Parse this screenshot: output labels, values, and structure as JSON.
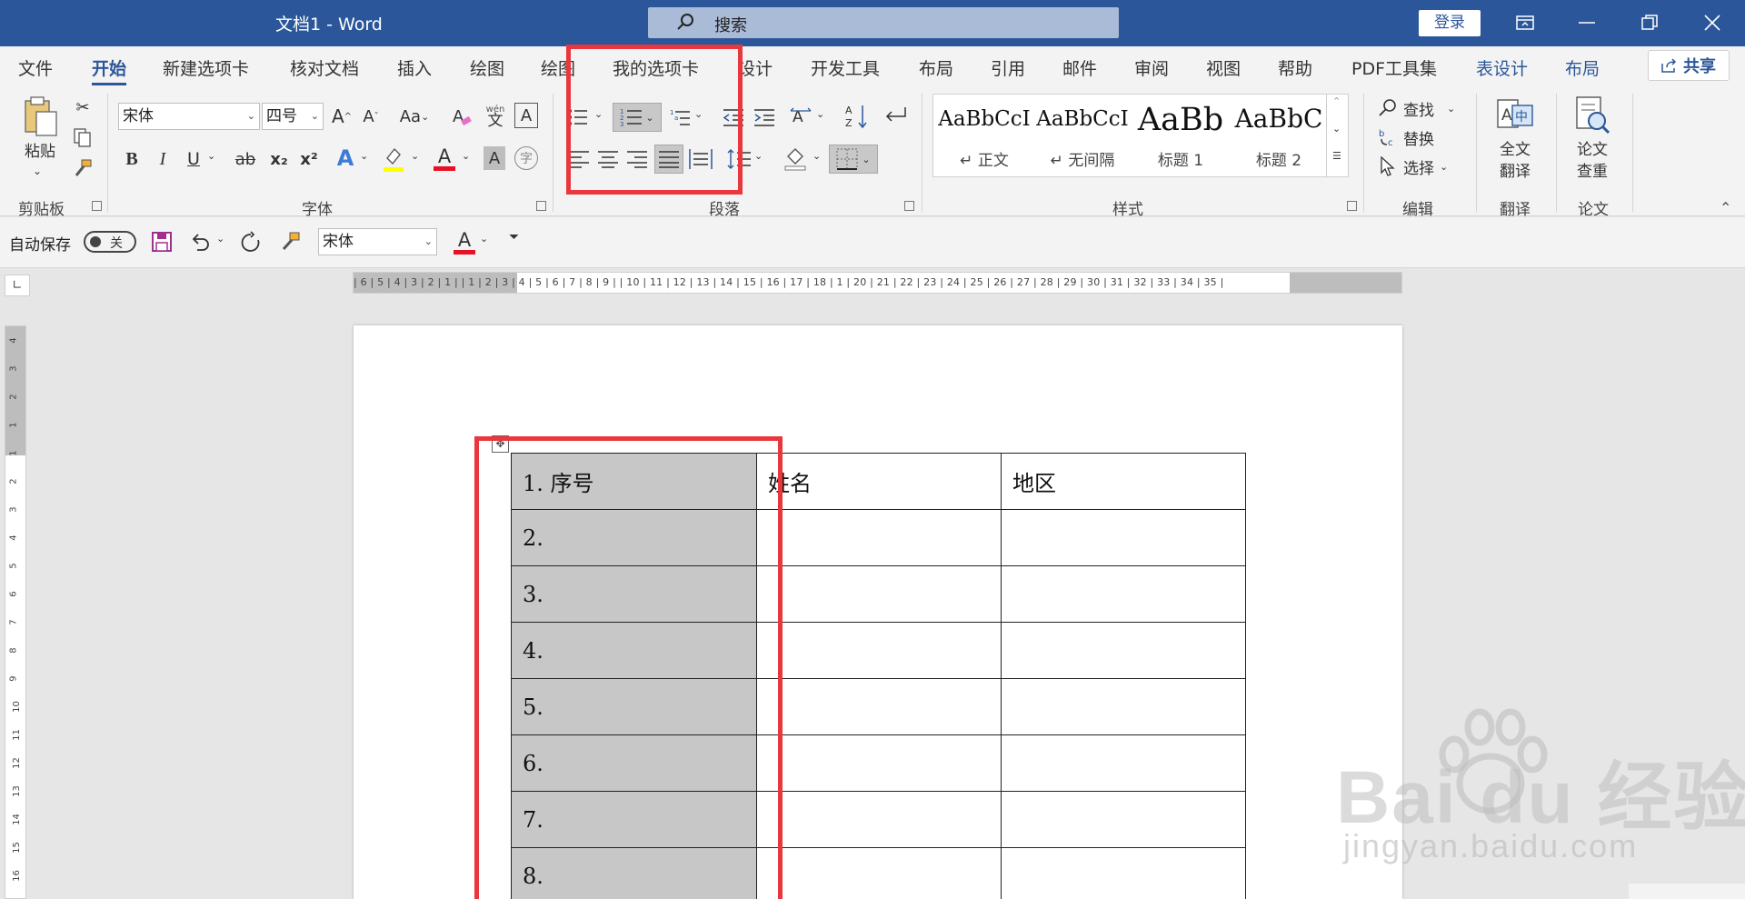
{
  "titlebar": {
    "doc_title": "文档1  -  Word",
    "search_placeholder": "搜索",
    "login": "登录"
  },
  "tabs": [
    "文件",
    "开始",
    "新建选项卡",
    "核对文档",
    "插入",
    "绘图",
    "绘图",
    "我的选项卡",
    "设计",
    "开发工具",
    "布局",
    "引用",
    "邮件",
    "审阅",
    "视图",
    "帮助",
    "PDF工具集",
    "表设计",
    "布局"
  ],
  "active_tab": "开始",
  "share": "共享",
  "ribbon": {
    "clipboard": {
      "label": "剪贴板",
      "paste": "粘贴"
    },
    "font": {
      "label": "字体",
      "font_name": "宋体",
      "font_size": "四号",
      "change_case": "Aa",
      "phonetic": "wén",
      "bold": "B",
      "italic": "I",
      "underline": "U",
      "strike": "ab",
      "subscript": "x₂",
      "superscript": "x²",
      "highlight_color": "#ffff00",
      "font_color": "#e81123",
      "enclose": "字"
    },
    "paragraph": {
      "label": "段落"
    },
    "styles": {
      "label": "样式",
      "items": [
        {
          "preview": "AaBbCcI",
          "name": "↵ 正文"
        },
        {
          "preview": "AaBbCcI",
          "name": "↵ 无间隔"
        },
        {
          "preview": "AaBb",
          "name": "标题 1"
        },
        {
          "preview": "AaBbC",
          "name": "标题 2"
        }
      ]
    },
    "editing": {
      "label": "编辑",
      "find": "查找",
      "replace": "替换",
      "select": "选择"
    },
    "translate": {
      "label": "翻译",
      "full_text": "全文",
      "translate": "翻译"
    },
    "paper": {
      "label": "论文",
      "paper": "论文",
      "check": "查重"
    }
  },
  "qat": {
    "autosave": "自动保存",
    "autosave_state": "关",
    "font_name": "宋体"
  },
  "ruler": {
    "numbers": "| 6 | 5 | 4 | 3 | 2 | 1 |      | 1 | 2 | 3 | 4 | 5 | 6 | 7 | 8 | 9 |      | 10 | 11 | 12 | 13 | 14 | 15 | 16 | 17 | 18 | 1      | 20 | 21 | 22 | 23 | 24 | 25 | 26 | 27 | 28 | 29      | 30 | 31 | 32 | 33 | 34 | 35 |",
    "vertical": [
      "4",
      "3",
      "2",
      "1",
      "1",
      "2",
      "3",
      "4",
      "5",
      "6",
      "7",
      "8",
      "9",
      "10",
      "11",
      "12",
      "13",
      "14",
      "15",
      "16"
    ]
  },
  "table": {
    "header": [
      "1.   序号",
      "姓名",
      "地区"
    ],
    "rows": [
      [
        "2.",
        "",
        ""
      ],
      [
        "3.",
        "",
        ""
      ],
      [
        "4.",
        "",
        ""
      ],
      [
        "5.",
        "",
        ""
      ],
      [
        "6.",
        "",
        ""
      ],
      [
        "7.",
        "",
        ""
      ],
      [
        "8.",
        "",
        ""
      ]
    ]
  },
  "watermark": {
    "brand": "Bai  du 经验",
    "url": "jingyan.baidu.com"
  },
  "colors": {
    "brand": "#2b579a",
    "annotation": "#e8383d",
    "selection": "#c7c7c7"
  }
}
